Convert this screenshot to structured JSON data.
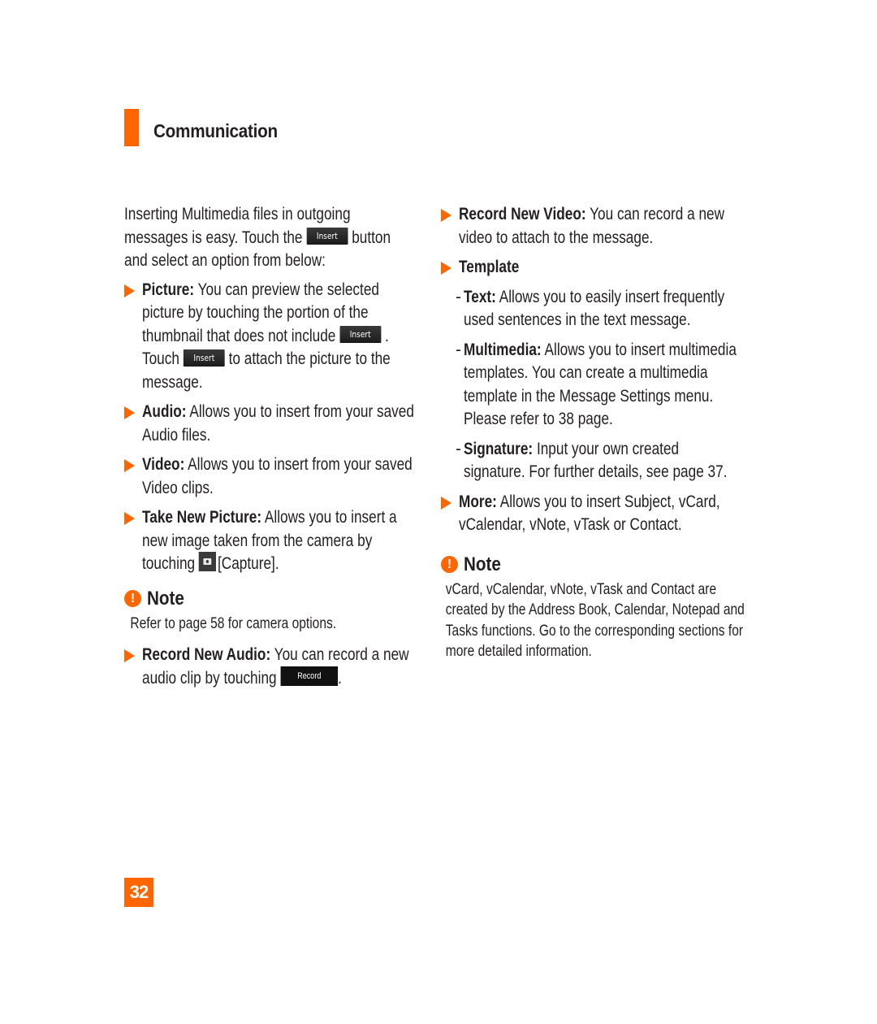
{
  "header": {
    "title": "Communication",
    "accent_color": "#ff6600"
  },
  "left": {
    "intro": {
      "before": "Inserting Multimedia files in outgoing messages is easy. Touch the",
      "button": "Insert",
      "after": "button and select an option from below:"
    },
    "picture": {
      "label": "Picture:",
      "text1": "You can preview the selected picture by touching the portion of the thumbnail that does not include",
      "button1": "Insert",
      "text2": ". Touch",
      "button2": "Insert",
      "text3": "to attach the picture to the message."
    },
    "audio": {
      "label": "Audio:",
      "text": "Allows you to insert from your saved Audio files."
    },
    "video": {
      "label": "Video:",
      "text": "Allows you to insert from your saved Video clips."
    },
    "take_picture": {
      "label": "Take New Picture:",
      "text1": "Allows you to insert a new image taken from the camera by touching",
      "icon": "camera-icon",
      "text2": "[Capture]."
    },
    "note": {
      "icon": "exclamation-icon",
      "title": "Note",
      "body": "Refer to page 58 for camera options."
    },
    "record_audio": {
      "label": "Record New Audio:",
      "text": "You can record a new audio clip by touching",
      "button": "Record",
      "end": "."
    }
  },
  "right": {
    "record_video": {
      "label": "Record New Video:",
      "text": "You can record a new video to attach to the message."
    },
    "template": {
      "label": "Template",
      "items": [
        {
          "label": "Text:",
          "text": "Allows you to easily insert frequently used sentences in the text message."
        },
        {
          "label": "Multimedia:",
          "text": "Allows you to insert multimedia templates. You can create a multimedia template in the Message Settings menu. Please refer to 38 page."
        },
        {
          "label": "Signature:",
          "text": "Input your own created signature. For further details, see page 37."
        }
      ]
    },
    "more": {
      "label": "More:",
      "text": "Allows you to insert Subject, vCard, vCalendar, vNote, vTask or Contact."
    },
    "note": {
      "icon": "exclamation-icon",
      "title": "Note",
      "body": "vCard, vCalendar, vNote, vTask and Contact are created by the Address Book, Calendar, Notepad and Tasks functions. Go to the corresponding sections for more detailed information."
    }
  },
  "footer": {
    "page_number": "32"
  }
}
